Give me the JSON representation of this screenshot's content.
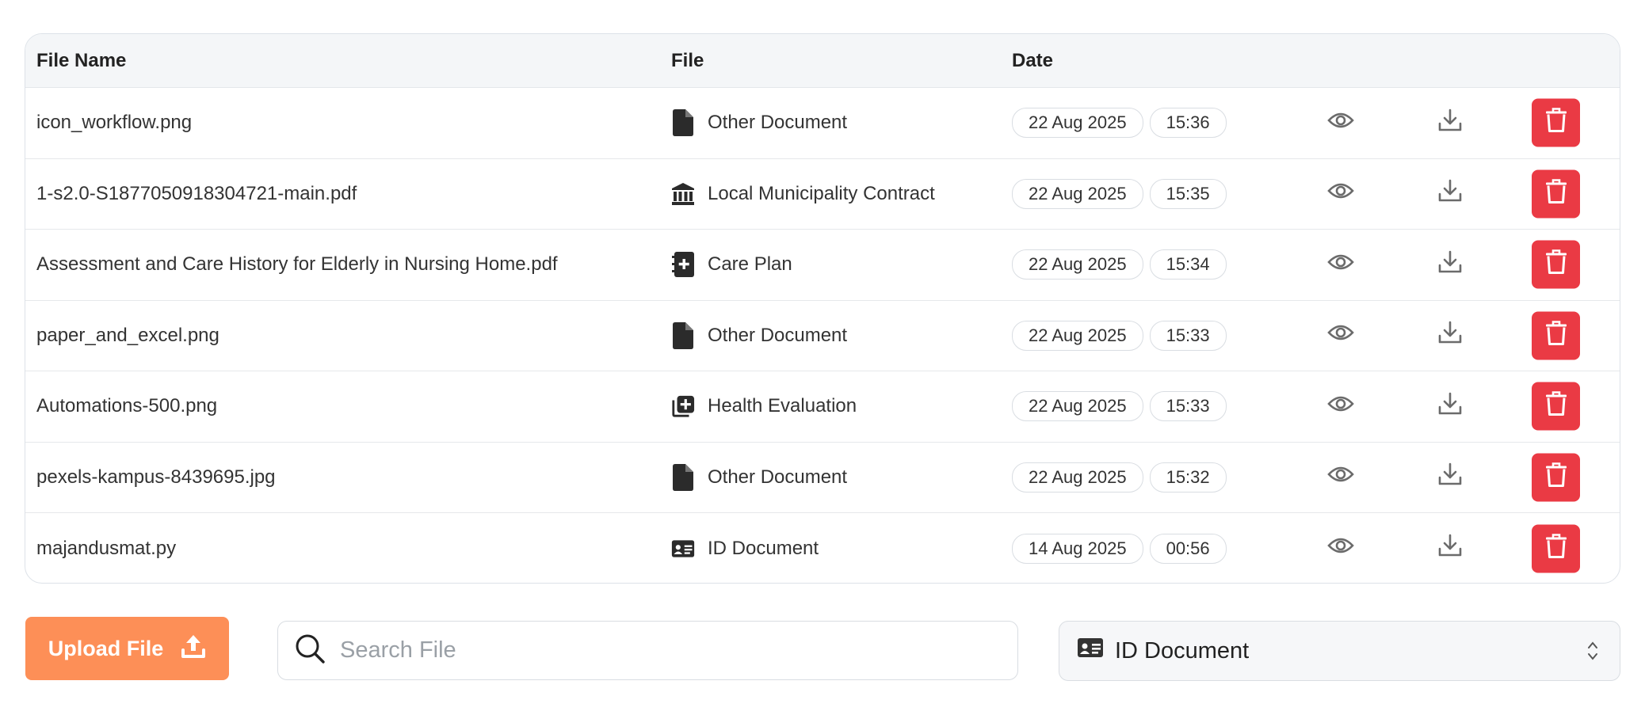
{
  "table": {
    "headers": {
      "file_name": "File Name",
      "file": "File",
      "date": "Date"
    },
    "rows": [
      {
        "name": "icon_workflow.png",
        "type": "Other Document",
        "type_icon": "file-icon",
        "date": "22 Aug 2025",
        "time": "15:36"
      },
      {
        "name": "1-s2.0-S1877050918304721-main.pdf",
        "type": "Local Municipality Contract",
        "type_icon": "bank-icon",
        "date": "22 Aug 2025",
        "time": "15:35"
      },
      {
        "name": "Assessment and Care History for Elderly in Nursing Home.pdf",
        "type": "Care Plan",
        "type_icon": "medical-book-icon",
        "date": "22 Aug 2025",
        "time": "15:34"
      },
      {
        "name": "paper_and_excel.png",
        "type": "Other Document",
        "type_icon": "file-icon",
        "date": "22 Aug 2025",
        "time": "15:33"
      },
      {
        "name": "Automations-500.png",
        "type": "Health Evaluation",
        "type_icon": "medical-copy-icon",
        "date": "22 Aug 2025",
        "time": "15:33"
      },
      {
        "name": "pexels-kampus-8439695.jpg",
        "type": "Other Document",
        "type_icon": "file-icon",
        "date": "22 Aug 2025",
        "time": "15:32"
      },
      {
        "name": "majandusmat.py",
        "type": "ID Document",
        "type_icon": "id-card-icon",
        "date": "14 Aug 2025",
        "time": "00:56"
      }
    ]
  },
  "toolbar": {
    "upload_label": "Upload File",
    "search_placeholder": "Search File",
    "search_value": "",
    "filter_selected": "ID Document"
  },
  "colors": {
    "upload": "#fd8f57",
    "delete": "#ea3a44",
    "header_bg": "#f4f6f8"
  }
}
